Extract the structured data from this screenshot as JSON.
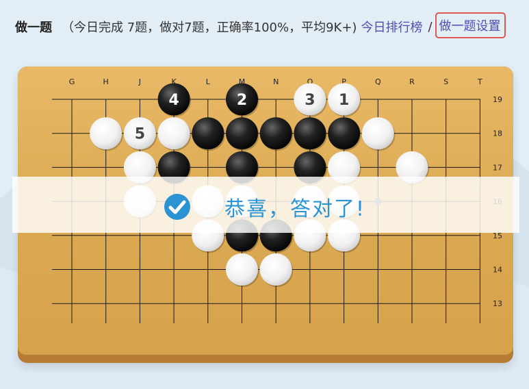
{
  "header": {
    "title": "做一题",
    "stats": "（今日完成 7题，做对7题，正确率100%，平均9K+)",
    "rank_link": "今日排行榜",
    "separator": "/",
    "settings_link": "做一题设置"
  },
  "board": {
    "col_labels": [
      "G",
      "H",
      "J",
      "K",
      "L",
      "M",
      "N",
      "O",
      "P",
      "Q",
      "R",
      "S",
      "T"
    ],
    "row_labels": [
      "19",
      "18",
      "17",
      "16",
      "15",
      "14",
      "13"
    ],
    "stones": [
      {
        "point": "K19",
        "color": "black",
        "label": "4"
      },
      {
        "point": "M19",
        "color": "black",
        "label": "2"
      },
      {
        "point": "O19",
        "color": "white",
        "label": "3"
      },
      {
        "point": "P19",
        "color": "white",
        "label": "1"
      },
      {
        "point": "H18",
        "color": "white",
        "label": ""
      },
      {
        "point": "J18",
        "color": "white",
        "label": "5"
      },
      {
        "point": "K18",
        "color": "white",
        "label": ""
      },
      {
        "point": "L18",
        "color": "black",
        "label": ""
      },
      {
        "point": "M18",
        "color": "black",
        "label": ""
      },
      {
        "point": "N18",
        "color": "black",
        "label": ""
      },
      {
        "point": "O18",
        "color": "black",
        "label": ""
      },
      {
        "point": "P18",
        "color": "black",
        "label": ""
      },
      {
        "point": "Q18",
        "color": "white",
        "label": ""
      },
      {
        "point": "J17",
        "color": "white",
        "label": ""
      },
      {
        "point": "K17",
        "color": "black",
        "label": ""
      },
      {
        "point": "M17",
        "color": "black",
        "label": ""
      },
      {
        "point": "O17",
        "color": "black",
        "label": ""
      },
      {
        "point": "P17",
        "color": "white",
        "label": ""
      },
      {
        "point": "R17",
        "color": "white",
        "label": ""
      },
      {
        "point": "J16",
        "color": "white",
        "label": ""
      },
      {
        "point": "L16",
        "color": "white",
        "label": ""
      },
      {
        "point": "M16",
        "color": "white",
        "label": ""
      },
      {
        "point": "O16",
        "color": "white",
        "label": ""
      },
      {
        "point": "P16",
        "color": "white",
        "label": ""
      },
      {
        "point": "L15",
        "color": "white",
        "label": ""
      },
      {
        "point": "M15",
        "color": "black",
        "label": ""
      },
      {
        "point": "N15",
        "color": "black",
        "label": ""
      },
      {
        "point": "O15",
        "color": "white",
        "label": ""
      },
      {
        "point": "P15",
        "color": "white",
        "label": ""
      },
      {
        "point": "M14",
        "color": "white",
        "label": ""
      },
      {
        "point": "N14",
        "color": "white",
        "label": ""
      }
    ],
    "marker": "Q16"
  },
  "result": {
    "message": "恭喜，答对了!",
    "icon": "check-circle-icon",
    "color": "#2a93d3"
  },
  "colors": {
    "link": "#4a4fb8",
    "highlight_border": "#e05555"
  }
}
